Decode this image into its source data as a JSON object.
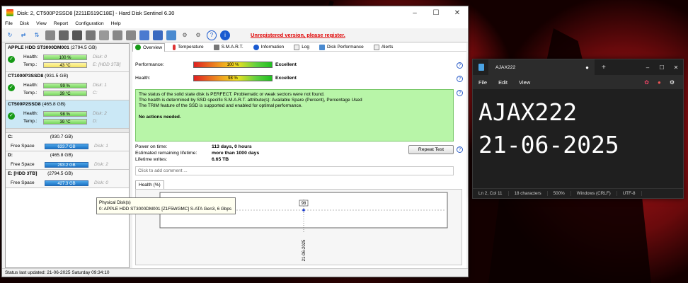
{
  "hds": {
    "title": "Disk: 2, CT500P2SSD8 [2211E619C18E]  -  Hard Disk Sentinel 6.30",
    "menu": [
      "File",
      "Disk",
      "View",
      "Report",
      "Configuration",
      "Help"
    ],
    "unregistered": "Unregistered version, please register.",
    "disks": [
      {
        "name": "APPLE HDD ST3000DM001",
        "size": "(2794.5 GB)",
        "health": "100 %",
        "temp": "43 °C",
        "disk_label": "Disk: 0",
        "drive": "E: [HDD 3TB]",
        "temp_color": "yellow"
      },
      {
        "name": "CT1000P3SSD8",
        "size": "(931.5 GB)",
        "health": "99 %",
        "temp": "39 °C",
        "disk_label": "Disk: 1",
        "drive": "C:",
        "temp_color": "green"
      },
      {
        "name": "CT500P2SSD8",
        "size": "(465.8 GB)",
        "health": "98 %",
        "temp": "39 °C",
        "disk_label": "Disk: 2",
        "drive": "D:",
        "temp_color": "green"
      }
    ],
    "health_label": "Health:",
    "temp_label": "Temp.:",
    "volumes": [
      {
        "name": "C:",
        "size": "(930.7 GB)",
        "free": "633.7 GB",
        "disk": "Disk: 1"
      },
      {
        "name": "D:",
        "size": "(465.8 GB)",
        "free": "293.2 GB",
        "disk": "Disk: 2"
      },
      {
        "name": "E: [HDD 3TB]",
        "size": "(2794.5 GB)",
        "free": "427.3 GB",
        "disk": "Disk: 0"
      }
    ],
    "free_label": "Free Space",
    "tooltip_line1": "Physical Disk(s)",
    "tooltip_line2": "0: APPLE HDD ST3000DM001 [Z1F5WGMC] S-ATA Gen3, 6 Gbps",
    "tabs": [
      "Overview",
      "Temperature",
      "S.M.A.R.T.",
      "Information",
      "Log",
      "Disk Performance",
      "Alerts"
    ],
    "performance_label": "Performance:",
    "performance_value": "100 %",
    "performance_text": "Excellent",
    "health_label2": "Health:",
    "health_value": "98 %",
    "health_text": "Excellent",
    "status_lines": [
      "The status of the solid state disk is PERFECT. Problematic or weak sectors were not found.",
      "The health is determined by SSD specific S.M.A.R.T. attribute(s):  Available Spare (Percent), Percentage Used",
      "The TRIM feature of the SSD is supported and enabled for optimal performance."
    ],
    "status_action": "No actions needed.",
    "power_on_label": "Power on time:",
    "power_on_value": "113 days, 0 hours",
    "remaining_label": "Estimated remaining lifetime:",
    "remaining_value": "more than 1000 days",
    "writes_label": "Lifetime writes:",
    "writes_value": "6.65 TB",
    "repeat_label": "Repeat Test",
    "comment_placeholder": "Click to add comment ...",
    "health_tab": "Health (%)",
    "statusbar": "Status last updated: 21-06-2025 Saturday 09:34:10"
  },
  "chart_data": {
    "type": "line",
    "title": "",
    "series": [
      {
        "values": [
          98
        ]
      }
    ],
    "x": [
      "21-06-2025"
    ],
    "xlabel": "",
    "ylabel": "",
    "ytick": "98",
    "data_label": "98"
  },
  "notepad": {
    "tab_title": "AJAX222",
    "menu": [
      "File",
      "Edit",
      "View"
    ],
    "line1": "AJAX222",
    "line2": "21-06-2025",
    "status": [
      "Ln 2, Col 11",
      "18 characters",
      "500%",
      "Windows (CRLF)",
      "UTF-8"
    ]
  },
  "colors": {
    "unregistered": "#e00000",
    "status_bg": "#b8f5a8",
    "selected": "#cbe8f6",
    "notepad_bg": "#1f1f1f"
  }
}
